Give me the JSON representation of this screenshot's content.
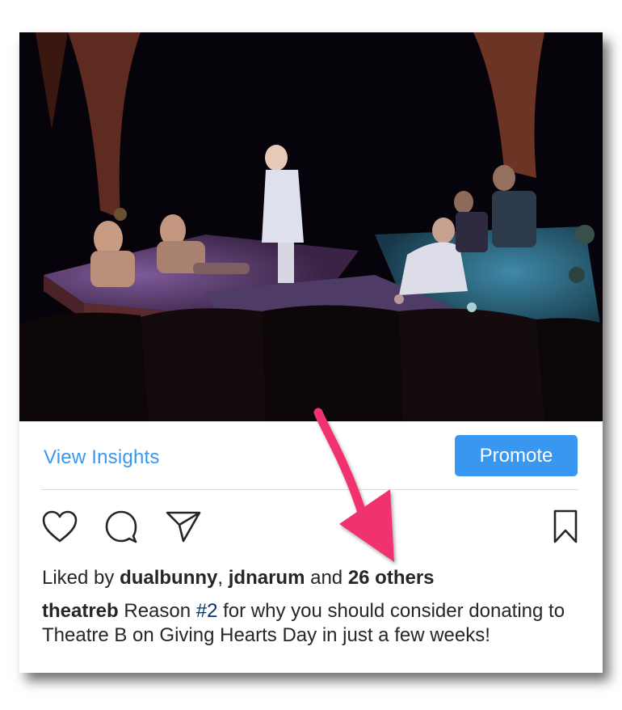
{
  "post": {
    "view_insights": "View Insights",
    "promote": "Promote",
    "likes": {
      "prefix": "Liked by ",
      "user1": "dualbunny",
      "sep": ", ",
      "user2": "jdnarum",
      "and": " and ",
      "others": "26 others"
    },
    "caption": {
      "username": "theatreb",
      "pre_tag": " Reason ",
      "hashtag": "#2",
      "text": " for why you should consider donating to Theatre B on Giving Hearts Day in just a few weeks!"
    }
  },
  "icons": {
    "like": "heart-icon",
    "comment": "comment-bubble-icon",
    "share": "paper-plane-icon",
    "save": "bookmark-icon",
    "annotation": "pink-arrow"
  },
  "colors": {
    "accent": "#3897f0",
    "annotation": "#f0336e",
    "text": "#262626"
  }
}
